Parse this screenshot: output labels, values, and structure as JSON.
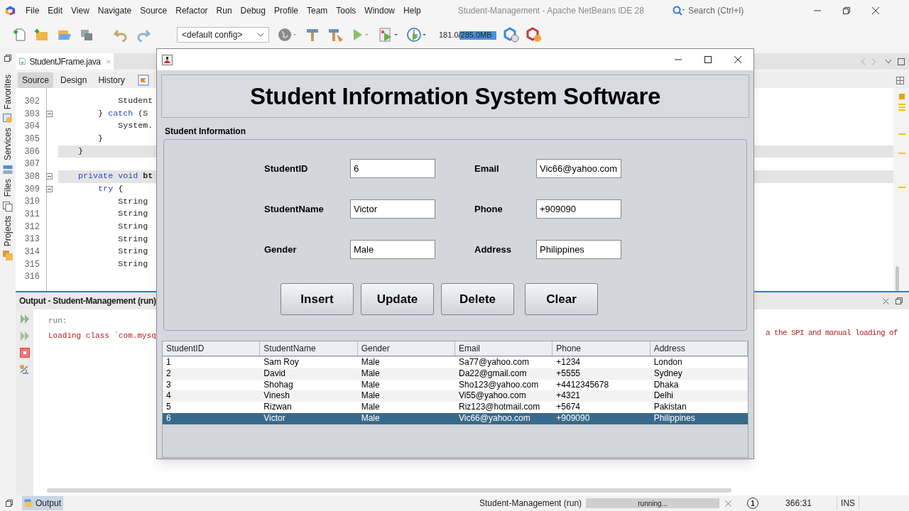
{
  "ide": {
    "title": "Student-Management - Apache NetBeans IDE 28",
    "menu": [
      "File",
      "Edit",
      "View",
      "Navigate",
      "Source",
      "Refactor",
      "Run",
      "Debug",
      "Profile",
      "Team",
      "Tools",
      "Window",
      "Help"
    ],
    "search": {
      "placeholder": "Search (Ctrl+I)"
    },
    "toolbar": {
      "config": "<default config>",
      "memory": {
        "text": "181.0/285.0MB",
        "level": 0.64
      }
    }
  },
  "side_tabs": [
    {
      "label": "Favorites"
    },
    {
      "label": "Services"
    },
    {
      "label": "Files"
    },
    {
      "label": "Projects"
    }
  ],
  "editor": {
    "tab": {
      "label": "StudentJFrame.java"
    },
    "views": [
      {
        "label": "Source",
        "selected": true
      },
      {
        "label": "Design",
        "selected": false
      },
      {
        "label": "History",
        "selected": false
      }
    ],
    "lines": [
      {
        "number": "302",
        "collapsible": false,
        "highlighted": false,
        "tokens": [
          {
            "text": "            Student",
            "kind": "plain"
          }
        ]
      },
      {
        "number": "303",
        "collapsible": true,
        "highlighted": false,
        "tokens": [
          {
            "text": "        } ",
            "kind": "plain"
          },
          {
            "text": "catch",
            "kind": "keyword"
          },
          {
            "text": " (S",
            "kind": "plain"
          }
        ]
      },
      {
        "number": "304",
        "collapsible": false,
        "highlighted": false,
        "tokens": [
          {
            "text": "            System.",
            "kind": "plain"
          }
        ]
      },
      {
        "number": "305",
        "collapsible": false,
        "highlighted": false,
        "tokens": [
          {
            "text": "        }",
            "kind": "plain"
          }
        ]
      },
      {
        "number": "306",
        "collapsible": false,
        "highlighted": true,
        "tokens": [
          {
            "text": "    }",
            "kind": "plain"
          }
        ]
      },
      {
        "number": "307",
        "collapsible": false,
        "highlighted": false
      },
      {
        "number": "308",
        "collapsible": true,
        "highlighted": true,
        "tokens": [
          {
            "text": "    private void ",
            "kind": "keyword"
          },
          {
            "text": "bt",
            "kind": "bold"
          }
        ]
      },
      {
        "number": "309",
        "collapsible": true,
        "highlighted": false,
        "tokens": [
          {
            "text": "        try",
            "kind": "keyword"
          },
          {
            "text": " {",
            "kind": "plain"
          }
        ]
      },
      {
        "number": "310",
        "collapsible": false,
        "highlighted": false,
        "tokens": [
          {
            "text": "            String",
            "kind": "plain"
          }
        ]
      },
      {
        "number": "311",
        "collapsible": false,
        "highlighted": false,
        "tokens": [
          {
            "text": "            String",
            "kind": "plain"
          }
        ]
      },
      {
        "number": "312",
        "collapsible": false,
        "highlighted": false,
        "tokens": [
          {
            "text": "            String",
            "kind": "plain"
          }
        ]
      },
      {
        "number": "313",
        "collapsible": false,
        "highlighted": false,
        "tokens": [
          {
            "text": "            String",
            "kind": "plain"
          }
        ]
      },
      {
        "number": "314",
        "collapsible": false,
        "highlighted": false,
        "tokens": [
          {
            "text": "            String",
            "kind": "plain"
          }
        ]
      },
      {
        "number": "315",
        "collapsible": false,
        "highlighted": false,
        "tokens": [
          {
            "text": "            String",
            "kind": "plain"
          }
        ]
      },
      {
        "number": "316",
        "collapsible": false,
        "highlighted": false
      }
    ]
  },
  "output": {
    "title": "Output - Student-Management (run)",
    "lines": [
      {
        "text": "run:",
        "kind": "info"
      },
      {
        "text": "Loading class `com.mysq",
        "kind": "error",
        "tail": "a the SPI and manual loading of"
      }
    ]
  },
  "dialog": {
    "heading": "Student Information System Software",
    "section": "Student Information",
    "fields": [
      {
        "label": "StudentID",
        "value": "6"
      },
      {
        "label": "Email",
        "value": "Vic66@yahoo.com"
      },
      {
        "label": "StudentName",
        "value": "Victor"
      },
      {
        "label": "Phone",
        "value": "+909090"
      },
      {
        "label": "Gender",
        "value": "Male"
      },
      {
        "label": "Address",
        "value": "Philippines"
      }
    ],
    "buttons": [
      "Insert",
      "Update",
      "Delete",
      "Clear"
    ],
    "table": {
      "columns": [
        "StudentID",
        "StudentName",
        "Gender",
        "Email",
        "Phone",
        "Address"
      ],
      "rows": [
        {
          "cells": [
            "1",
            "Sam Roy",
            "Male",
            "Sa77@yahoo.com",
            "+1234",
            "London"
          ],
          "selected": false
        },
        {
          "cells": [
            "2",
            "David",
            "Male",
            "Da22@gmail.com",
            "+5555",
            "Sydney"
          ],
          "selected": false
        },
        {
          "cells": [
            "3",
            "Shohag",
            "Male",
            "Sho123@yahoo.com",
            "+4412345678",
            "Dhaka"
          ],
          "selected": false
        },
        {
          "cells": [
            "4",
            "Vinesh",
            "Male",
            "Vi55@yahoo.com",
            "+4321",
            "Delhi"
          ],
          "selected": false
        },
        {
          "cells": [
            "5",
            "Rizwan",
            "Male",
            "Riz123@hotmail.com",
            "+5674",
            "Pakistan"
          ],
          "selected": false
        },
        {
          "cells": [
            "6",
            "Victor",
            "Male",
            "Vic66@yahoo.com",
            "+909090",
            "Philippines"
          ],
          "selected": true
        }
      ]
    }
  },
  "status_bar": {
    "output_tab": "Output",
    "task": "Student-Management (run)",
    "progress": {
      "text": "running...",
      "level": 1
    },
    "notifications": "1",
    "position": "366:31",
    "mode": "INS"
  }
}
